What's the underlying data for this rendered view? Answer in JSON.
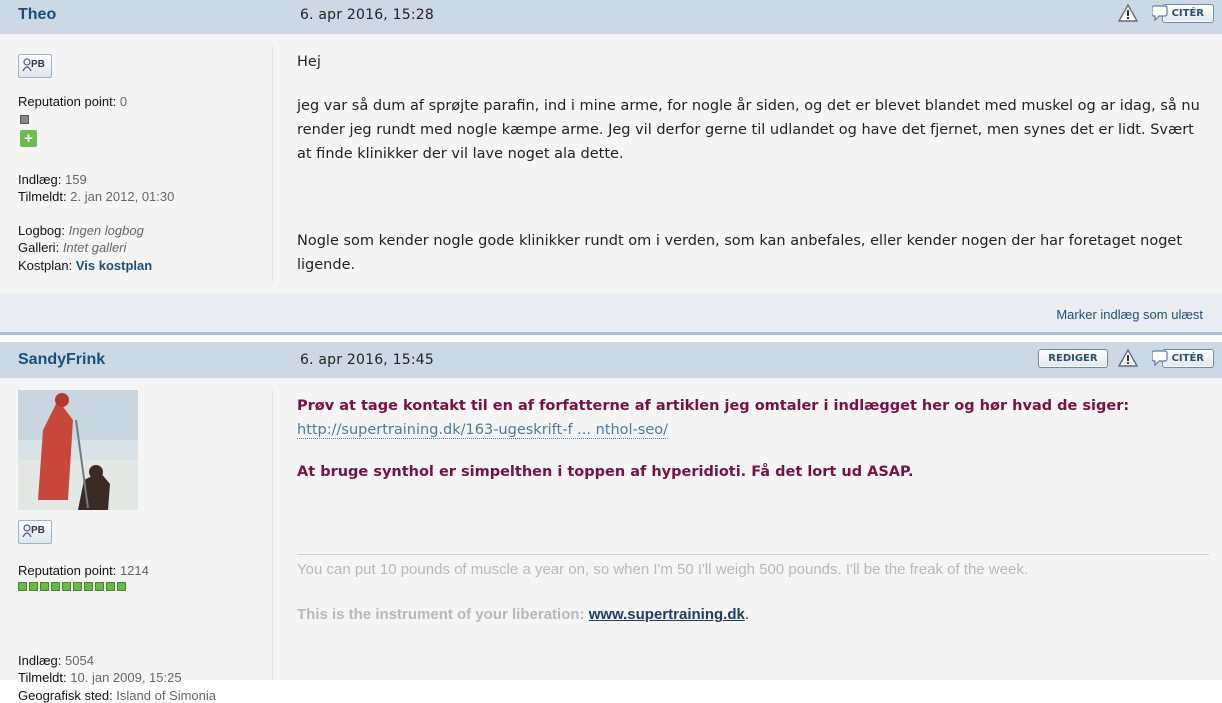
{
  "posts": [
    {
      "author": "Theo",
      "date": "6. apr 2016, 15:28",
      "buttons": {
        "quote": "CITÉR"
      },
      "profile": {
        "pb_label": "PB",
        "rep_label": "Reputation point:",
        "rep_value": "0",
        "posts_label": "Indlæg:",
        "posts_value": "159",
        "joined_label": "Tilmeldt:",
        "joined_value": "2. jan 2012, 01:30",
        "logbook_label": "Logbog:",
        "logbook_value": "Ingen logbog",
        "gallery_label": "Galleri:",
        "gallery_value": "Intet galleri",
        "diet_label": "Kostplan:",
        "diet_value": "Vis kostplan"
      },
      "content": {
        "p1": "Hej",
        "p2": "jeg var så dum af sprøjte parafin, ind i mine arme, for nogle år siden, og det er blevet blandet med muskel og ar idag, så nu render jeg rundt med nogle kæmpe arme. Jeg vil derfor gerne til udlandet og have det fjernet, men synes det er lidt. Svært at finde klinikker der vil lave noget ala dette.",
        "p3": "Nogle som kender nogle gode klinikker rundt om i verden, som kan anbefales, eller kender nogen der har foretaget noget ligende."
      },
      "footer": {
        "mark_unread": "Marker indlæg som ulæst"
      }
    },
    {
      "author": "SandyFrink",
      "date": "6. apr 2016, 15:45",
      "buttons": {
        "edit": "REDIGER",
        "quote": "CITÉR"
      },
      "profile": {
        "pb_label": "PB",
        "rep_label": "Reputation point:",
        "rep_value": "1214",
        "rep_blocks": 10,
        "posts_label": "Indlæg:",
        "posts_value": "5054",
        "joined_label": "Tilmeldt:",
        "joined_value": "10. jan 2009, 15:25",
        "location_label": "Geografisk sted:",
        "location_value": "Island of Simonia"
      },
      "content": {
        "p1": "Prøv at tage kontakt til en af forfatterne af artiklen jeg omtaler i indlægget her og hør hvad de siger:",
        "link": "http://supertraining.dk/163-ugeskrift-f ... nthol-seo/",
        "p2": "At bruge synthol er simpelthen i toppen af hyperidioti. Få det lort ud ASAP."
      },
      "signature": {
        "line1": "You can put 10 pounds of muscle a year on, so when I'm 50 I'll weigh 500 pounds. I'll be the freak of the week.",
        "line2_prefix": "This is the instrument of your liberation: ",
        "line2_link": "www.supertraining.dk",
        "line2_suffix": "."
      }
    }
  ]
}
